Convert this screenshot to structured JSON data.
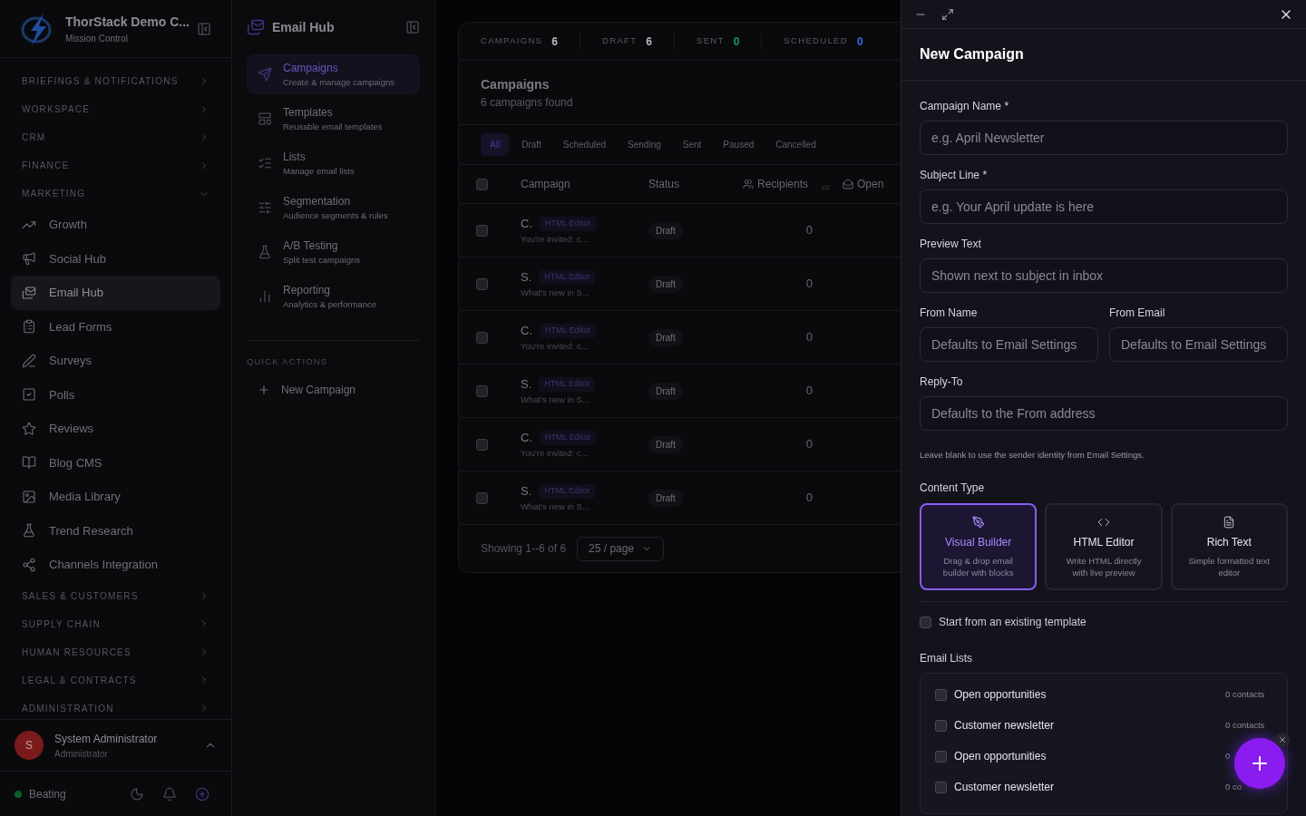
{
  "app": {
    "name": "ThorStack Demo C...",
    "subtitle": "Mission Control"
  },
  "nav": [
    {
      "kind": "section",
      "label": "BRIEFINGS & NOTIFICATIONS",
      "expanded": false
    },
    {
      "kind": "section",
      "label": "WORKSPACE",
      "expanded": false
    },
    {
      "kind": "section",
      "label": "CRM",
      "expanded": false
    },
    {
      "kind": "section",
      "label": "FINANCE",
      "expanded": false
    },
    {
      "kind": "section",
      "label": "MARKETING",
      "expanded": true
    },
    {
      "kind": "item",
      "label": "Growth",
      "selected": false
    },
    {
      "kind": "item",
      "label": "Social Hub",
      "selected": false
    },
    {
      "kind": "item",
      "label": "Email Hub",
      "selected": true
    },
    {
      "kind": "item",
      "label": "Lead Forms",
      "selected": false
    },
    {
      "kind": "item",
      "label": "Surveys",
      "selected": false
    },
    {
      "kind": "item",
      "label": "Polls",
      "selected": false
    },
    {
      "kind": "item",
      "label": "Reviews",
      "selected": false
    },
    {
      "kind": "item",
      "label": "Blog CMS",
      "selected": false
    },
    {
      "kind": "item",
      "label": "Media Library",
      "selected": false
    },
    {
      "kind": "item",
      "label": "Trend Research",
      "selected": false
    },
    {
      "kind": "item",
      "label": "Channels Integration",
      "selected": false
    },
    {
      "kind": "section",
      "label": "SALES & CUSTOMERS",
      "expanded": false
    },
    {
      "kind": "section",
      "label": "SUPPLY CHAIN",
      "expanded": false
    },
    {
      "kind": "section",
      "label": "HUMAN RESOURCES",
      "expanded": false
    },
    {
      "kind": "section",
      "label": "LEGAL & CONTRACTS",
      "expanded": false
    },
    {
      "kind": "section",
      "label": "ADMINISTRATION",
      "expanded": false
    }
  ],
  "user": {
    "initial": "S",
    "name": "System Administrator",
    "role": "Administrator",
    "menu_expanded": true
  },
  "status": {
    "label": "Beating",
    "online": true
  },
  "hub": {
    "title": "Email Hub",
    "items": [
      {
        "title": "Campaigns",
        "subtitle": "Create & manage campaigns",
        "selected": true
      },
      {
        "title": "Templates",
        "subtitle": "Reusable email templates",
        "selected": false
      },
      {
        "title": "Lists",
        "subtitle": "Manage email lists",
        "selected": false
      },
      {
        "title": "Segmentation",
        "subtitle": "Audience segments & rules",
        "selected": false
      },
      {
        "title": "A/B Testing",
        "subtitle": "Split test campaigns",
        "selected": false
      },
      {
        "title": "Reporting",
        "subtitle": "Analytics & performance",
        "selected": false
      }
    ],
    "quick_actions": {
      "heading": "QUICK ACTIONS",
      "items": [
        "New Campaign"
      ]
    }
  },
  "stats": [
    {
      "label": "CAMPAIGNS",
      "value": "6",
      "color": "#b8b8c0"
    },
    {
      "label": "DRAFT",
      "value": "6",
      "color": "#b8b8c0"
    },
    {
      "label": "SENT",
      "value": "0",
      "color": "#0f9b6a"
    },
    {
      "label": "SCHEDULED",
      "value": "0",
      "color": "#2f6fd6"
    }
  ],
  "campaigns": {
    "title": "Campaigns",
    "subtitle": "6 campaigns found",
    "tabs": [
      {
        "label": "All",
        "selected": true
      },
      {
        "label": "Draft",
        "selected": false
      },
      {
        "label": "Scheduled",
        "selected": false
      },
      {
        "label": "Sending",
        "selected": false
      },
      {
        "label": "Sent",
        "selected": false
      },
      {
        "label": "Paused",
        "selected": false
      },
      {
        "label": "Cancelled",
        "selected": false
      }
    ],
    "columns": [
      "Campaign",
      "Status",
      "Recipients",
      "Open"
    ],
    "select_all": false,
    "rows": [
      {
        "name": "C.",
        "tag": "HTML Editor",
        "preview": "You're invited: c...",
        "status": "Draft",
        "recipients": "0",
        "checked": false
      },
      {
        "name": "S.",
        "tag": "HTML Editor",
        "preview": "What's new in S...",
        "status": "Draft",
        "recipients": "0",
        "checked": false
      },
      {
        "name": "C.",
        "tag": "HTML Editor",
        "preview": "You're invited: c...",
        "status": "Draft",
        "recipients": "0",
        "checked": false
      },
      {
        "name": "S.",
        "tag": "HTML Editor",
        "preview": "What's new in S...",
        "status": "Draft",
        "recipients": "0",
        "checked": false
      },
      {
        "name": "C.",
        "tag": "HTML Editor",
        "preview": "You're invited: c...",
        "status": "Draft",
        "recipients": "0",
        "checked": false
      },
      {
        "name": "S.",
        "tag": "HTML Editor",
        "preview": "What's new in S...",
        "status": "Draft",
        "recipients": "0",
        "checked": false
      }
    ],
    "showing": "Showing 1--6 of 6",
    "page_size": "25 / page"
  },
  "drawer": {
    "title": "New Campaign",
    "fields": [
      {
        "label": "Campaign Name *",
        "placeholder": "e.g. April Newsletter"
      },
      {
        "label": "Subject Line *",
        "placeholder": "e.g. Your April update is here"
      },
      {
        "label": "Preview Text",
        "placeholder": "Shown next to subject in inbox"
      }
    ],
    "sender_fields": [
      {
        "label": "From Name",
        "placeholder": "Defaults to Email Settings"
      },
      {
        "label": "From Email",
        "placeholder": "Defaults to Email Settings"
      }
    ],
    "reply_to": {
      "label": "Reply-To",
      "placeholder": "Defaults to the From address"
    },
    "hint": "Leave blank to use the sender identity from Email Settings.",
    "content_type": {
      "label": "Content Type",
      "options": [
        {
          "title": "Visual Builder",
          "description": "Drag & drop email builder with blocks",
          "selected": true
        },
        {
          "title": "HTML Editor",
          "description": "Write HTML directly with live preview",
          "selected": false
        },
        {
          "title": "Rich Text",
          "description": "Simple formatted text editor",
          "selected": false
        }
      ]
    },
    "template": {
      "label": "Start from an existing template",
      "checked": false
    },
    "email_lists": {
      "label": "Email Lists",
      "items": [
        {
          "name": "Open opportunities",
          "count": "0 contacts",
          "checked": false
        },
        {
          "name": "Customer newsletter",
          "count": "0 contacts",
          "checked": false
        },
        {
          "name": "Open opportunities",
          "count": "0",
          "checked": false
        },
        {
          "name": "Customer newsletter",
          "count": "0 co",
          "checked": false
        }
      ]
    }
  }
}
